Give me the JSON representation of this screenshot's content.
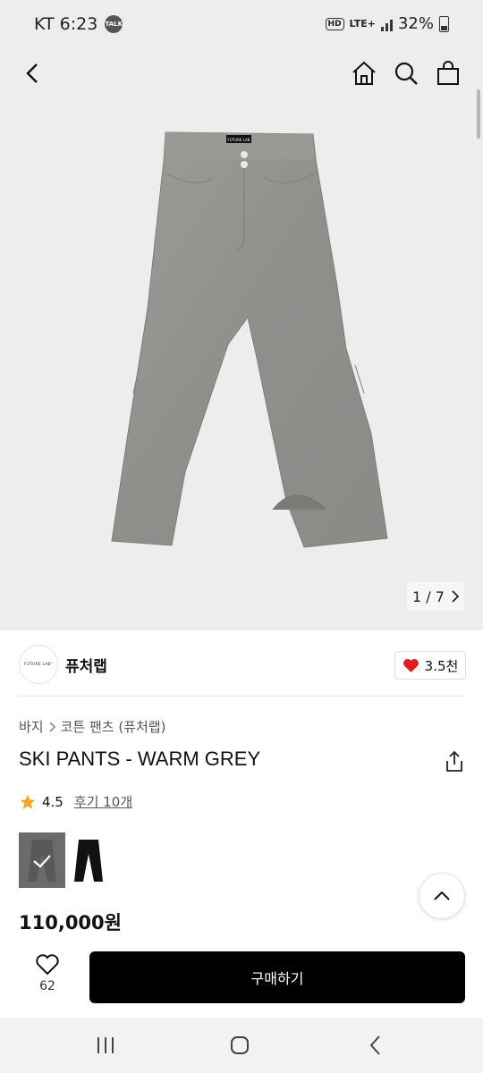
{
  "status_bar": {
    "carrier_time": "KT 6:23",
    "talk_badge": "TALK",
    "hd": "HD",
    "lte": "LTE+",
    "battery": "32%"
  },
  "nav": {
    "icons": [
      "back-icon",
      "home-icon",
      "search-icon",
      "shopping-bag-icon"
    ]
  },
  "gallery": {
    "counter": "1 / 7",
    "product_label_tag": "FUTURE LAB"
  },
  "brand": {
    "logo_text": "FUTURE LAB°",
    "name": "퓨처랩",
    "likes": "3.5천"
  },
  "breadcrumb": {
    "category": "바지",
    "subcategory": "코튼 팬츠 (퓨처랩)"
  },
  "product": {
    "title": "SKI PANTS - WARM GREY",
    "rating": "4.5",
    "reviews": "후기 10개",
    "price": "110,000원",
    "colors": [
      "#8a8a88",
      "#111111"
    ]
  },
  "bottom_bar": {
    "wish_count": "62",
    "buy_label": "구매하기"
  }
}
